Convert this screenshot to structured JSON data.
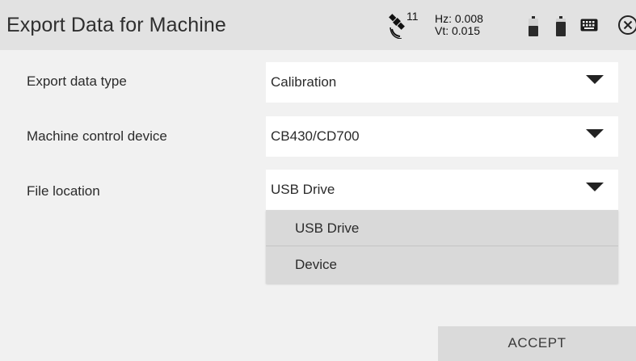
{
  "header": {
    "title": "Export Data for Machine",
    "satellite_count": "11",
    "precision_hz": "Hz: 0.008",
    "precision_vt": "Vt: 0.015",
    "icons": [
      "satellite-icon",
      "battery-icon",
      "battery-icon",
      "keyboard-icon",
      "close-icon"
    ]
  },
  "form": {
    "export_type": {
      "label": "Export data type",
      "value": "Calibration"
    },
    "device": {
      "label": "Machine control device",
      "value": "CB430/CD700"
    },
    "location": {
      "label": "File location",
      "value": "USB Drive"
    }
  },
  "dropdown": {
    "options": [
      "USB Drive",
      "Device"
    ]
  },
  "actions": {
    "accept_label": "ACCEPT"
  },
  "colors": {
    "header_bg": "#e2e2e2",
    "page_bg": "#f1f1f1",
    "dropdown_bg": "#d9d9d9",
    "button_bg": "#dadada"
  }
}
